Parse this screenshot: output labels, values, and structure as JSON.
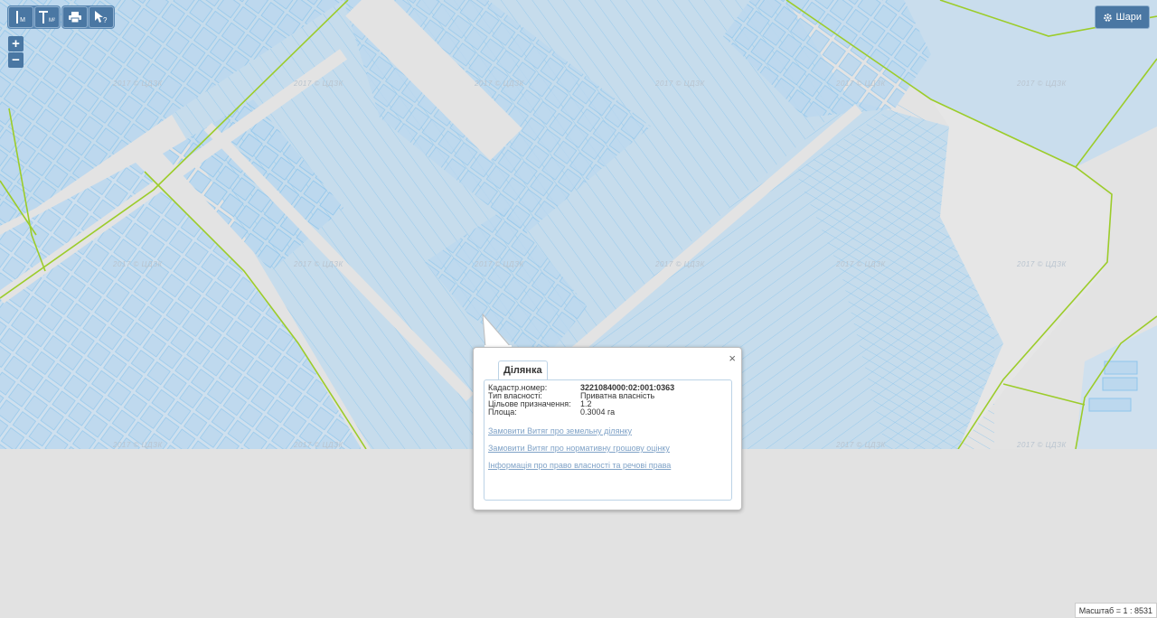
{
  "toolbar": {
    "measure_distance_icon": "ruler-m-icon",
    "measure_area_icon": "ruler-m2-icon",
    "print_icon": "print-icon",
    "identify_icon": "cursor-question-icon",
    "measure_distance_label": "M",
    "measure_area_label": "M²"
  },
  "zoom": {
    "in": "+",
    "out": "−"
  },
  "layers_button": {
    "label": "Шари",
    "icon": "gear-icon"
  },
  "watermark": "2017 © ЦДЗК",
  "popup": {
    "tab": "Ділянка",
    "fields": [
      {
        "label": "Кадастр.номер:",
        "value": "3221084000:02:001:0363"
      },
      {
        "label": "Тип власності:",
        "value": "Приватна власність"
      },
      {
        "label": "Цільове призначення:",
        "value": "1.2"
      },
      {
        "label": "Площа:",
        "value": "0.3004 га"
      }
    ],
    "links": [
      "Замовити Витяг про земельну ділянку",
      "Замовити Витяг про нормативну грошову оцінку",
      "Інформація про право власності та речові права"
    ],
    "close": "×"
  },
  "scale": "Масштаб = 1 : 8531",
  "colors": {
    "parcel_fill": "#c6dcec",
    "parcel_stroke": "#7fbfe8",
    "boundary_green": "#9ccc2a",
    "road": "#e3e3e3",
    "button_blue": "#4a77a3"
  }
}
